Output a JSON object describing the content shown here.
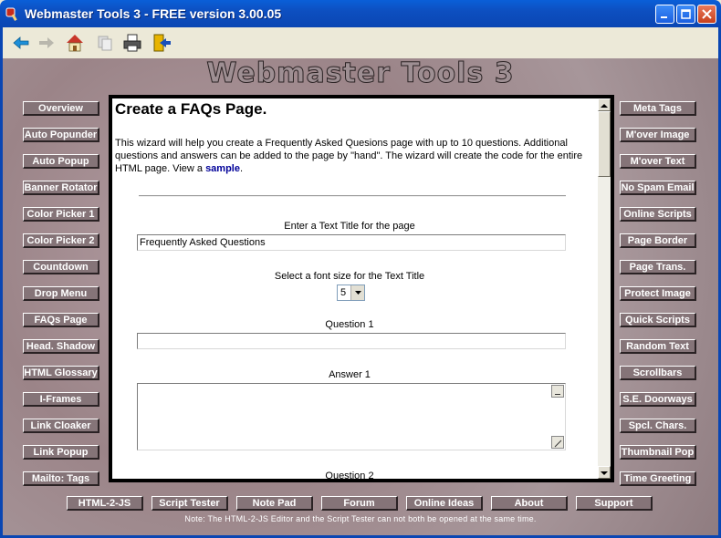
{
  "window": {
    "title": "Webmaster Tools 3 - FREE version 3.00.05"
  },
  "toolbar": {
    "icons": [
      "back-arrow-icon",
      "forward-arrow-icon",
      "home-icon",
      "copy-icon",
      "print-icon",
      "exit-icon"
    ]
  },
  "banner": "Webmaster Tools 3",
  "left_nav": [
    "Overview",
    "Auto Popunder",
    "Auto Popup",
    "Banner Rotator",
    "Color Picker 1",
    "Color Picker 2",
    "Countdown",
    "Drop Menu",
    "FAQs Page",
    "Head. Shadow",
    "HTML Glossary",
    "I-Frames",
    "Link Cloaker",
    "Link Popup",
    "Mailto: Tags"
  ],
  "right_nav": [
    "Meta Tags",
    "M'over Image",
    "M'over Text",
    "No Spam Email",
    "Online Scripts",
    "Page Border",
    "Page Trans.",
    "Protect Image",
    "Quick Scripts",
    "Random Text",
    "Scrollbars",
    "S.E. Doorways",
    "Spcl. Chars.",
    "Thumbnail Pop",
    "Time Greeting"
  ],
  "content": {
    "heading": "Create a FAQs Page.",
    "intro": "This wizard will help you create a Frequently Asked Quesions page with up to 10 questions. Additional questions and answers can be added to the page by \"hand\". The wizard will create the code for the entire HTML page. View a",
    "intro_link": "sample",
    "intro_end": ".",
    "title_label": "Enter a Text Title for the page",
    "title_value": "Frequently Asked Questions",
    "font_label": "Select a font size for the Text Title",
    "font_value": "5",
    "question1_label": "Question 1",
    "question1_value": "",
    "answer1_label": "Answer 1",
    "question2_label": "Question 2"
  },
  "bottom_nav": [
    "HTML-2-JS",
    "Script Tester",
    "Note Pad",
    "Forum",
    "Online Ideas",
    "About",
    "Support"
  ],
  "note": "Note: The HTML-2-JS Editor and the Script Tester can not both be opened at the same time."
}
